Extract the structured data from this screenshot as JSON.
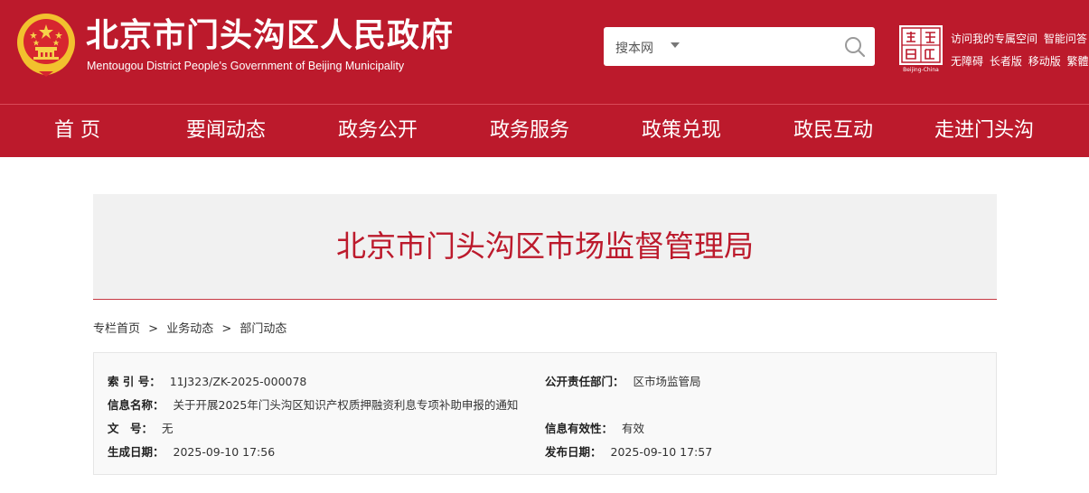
{
  "header": {
    "site_title": "北京市门头沟区人民政府",
    "site_subtitle": "Mentougou District People's Government of Beijing Municipality",
    "search": {
      "scope_label": "搜本网",
      "placeholder": ""
    },
    "capital_logo_caption": "Beijing-China",
    "links_row1": [
      "访问我的专属空间",
      "智能问答"
    ],
    "links_row2": [
      "无障碍",
      "长者版",
      "移动版",
      "繁體"
    ]
  },
  "nav": {
    "items": [
      "首 页",
      "要闻动态",
      "政务公开",
      "政务服务",
      "政策兑现",
      "政民互动",
      "走进门头沟"
    ]
  },
  "banner": {
    "title": "北京市门头沟区市场监督管理局"
  },
  "breadcrumb": {
    "items": [
      "专栏首页",
      "业务动态",
      "部门动态"
    ],
    "separator": ">"
  },
  "info": {
    "index_no": {
      "label": "索 引 号：",
      "value": "11J323/ZK-2025-000078"
    },
    "dept": {
      "label": "公开责任部门：",
      "value": "区市场监管局"
    },
    "name": {
      "label": "信息名称：",
      "value": "关于开展2025年门头沟区知识产权质押融资利息专项补助申报的通知"
    },
    "doc_no": {
      "label": "文　号：",
      "value": "无"
    },
    "validity": {
      "label": "信息有效性：",
      "value": "有效"
    },
    "created": {
      "label": "生成日期：",
      "value": "2025-09-10 17:56"
    },
    "published": {
      "label": "发布日期：",
      "value": "2025-09-10 17:57"
    }
  },
  "colors": {
    "brand_red": "#bc1a2c",
    "gold": "#f2c12e",
    "banner_bg": "#f1f1f1"
  },
  "icons": [
    "national-emblem-icon",
    "chevron-down-icon",
    "search-icon",
    "capital-logo-icon"
  ]
}
